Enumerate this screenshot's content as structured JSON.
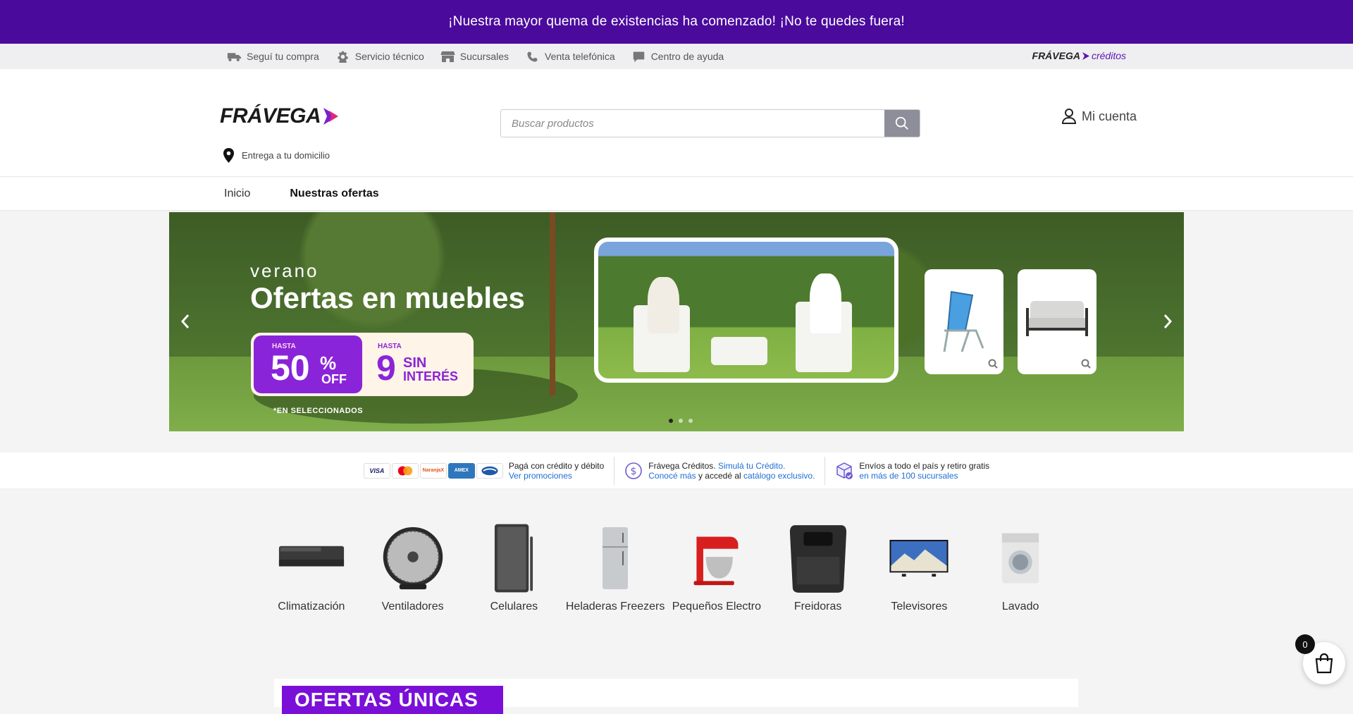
{
  "promo_bar": {
    "text": "¡Nuestra mayor quema de existencias ha comenzado! ¡No te quedes fuera!"
  },
  "utility": {
    "items": [
      {
        "label": "Seguí tu compra",
        "icon": "truck-icon"
      },
      {
        "label": "Servicio técnico",
        "icon": "gear-icon"
      },
      {
        "label": "Sucursales",
        "icon": "store-icon"
      },
      {
        "label": "Venta telefónica",
        "icon": "phone-icon"
      },
      {
        "label": "Centro de ayuda",
        "icon": "chat-icon"
      }
    ],
    "creditos_brand": "FRÁVEGA",
    "creditos_word": "créditos"
  },
  "header": {
    "logo_text": "FRÁVEGA",
    "search_placeholder": "Buscar productos",
    "account_label": "Mi cuenta",
    "delivery_label": "Entrega a tu domicilio"
  },
  "nav": {
    "items": [
      "Inicio",
      "Nuestras ofertas"
    ]
  },
  "hero": {
    "small": "verano",
    "title": "Ofertas en muebles",
    "badge_hasta_1": "HASTA",
    "badge_pct": "50",
    "badge_pct_sign": "%",
    "badge_off": "OFF",
    "badge_hasta_2": "HASTA",
    "badge_cuotas": "9",
    "badge_sin": "SIN",
    "badge_interes": "INTERÉS",
    "note": "*EN SELECCIONADOS"
  },
  "benefits": {
    "payments_line1": "Pagá con crédito y débito",
    "payments_link": "Ver promociones",
    "credits_line1_a": "Frávega Créditos.",
    "credits_line1_link": "Simulá tu Crédito.",
    "credits_line2_link1": "Conocé más",
    "credits_line2_mid": "y accedé al",
    "credits_line2_link2": "catálogo exclusivo.",
    "shipping_line1": "Envíos a todo el país y retiro gratis",
    "shipping_link": "en más de 100 sucursales",
    "card_labels": [
      "VISA",
      "",
      "NaranjaX",
      "AMEX",
      ""
    ]
  },
  "categories": [
    {
      "label": "Climatización"
    },
    {
      "label": "Ventiladores"
    },
    {
      "label": "Celulares"
    },
    {
      "label": "Heladeras Freezers"
    },
    {
      "label": "Pequeños Electro"
    },
    {
      "label": "Freidoras"
    },
    {
      "label": "Televisores"
    },
    {
      "label": "Lavado"
    }
  ],
  "ofertas_label": "OFERTAS ÚNICAS",
  "cart": {
    "count": "0"
  },
  "colors": {
    "brand_purple": "#4a0a9c",
    "accent": "#8a24d8",
    "link": "#1f6fd1"
  }
}
